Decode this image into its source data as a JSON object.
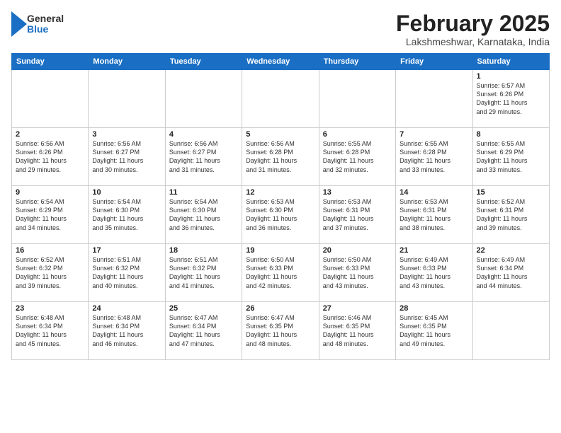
{
  "header": {
    "logo_general": "General",
    "logo_blue": "Blue",
    "month_title": "February 2025",
    "location": "Lakshmeshwar, Karnataka, India"
  },
  "days_of_week": [
    "Sunday",
    "Monday",
    "Tuesday",
    "Wednesday",
    "Thursday",
    "Friday",
    "Saturday"
  ],
  "weeks": [
    [
      {
        "day": "",
        "info": ""
      },
      {
        "day": "",
        "info": ""
      },
      {
        "day": "",
        "info": ""
      },
      {
        "day": "",
        "info": ""
      },
      {
        "day": "",
        "info": ""
      },
      {
        "day": "",
        "info": ""
      },
      {
        "day": "1",
        "info": "Sunrise: 6:57 AM\nSunset: 6:26 PM\nDaylight: 11 hours\nand 29 minutes."
      }
    ],
    [
      {
        "day": "2",
        "info": "Sunrise: 6:56 AM\nSunset: 6:26 PM\nDaylight: 11 hours\nand 29 minutes."
      },
      {
        "day": "3",
        "info": "Sunrise: 6:56 AM\nSunset: 6:27 PM\nDaylight: 11 hours\nand 30 minutes."
      },
      {
        "day": "4",
        "info": "Sunrise: 6:56 AM\nSunset: 6:27 PM\nDaylight: 11 hours\nand 31 minutes."
      },
      {
        "day": "5",
        "info": "Sunrise: 6:56 AM\nSunset: 6:28 PM\nDaylight: 11 hours\nand 31 minutes."
      },
      {
        "day": "6",
        "info": "Sunrise: 6:55 AM\nSunset: 6:28 PM\nDaylight: 11 hours\nand 32 minutes."
      },
      {
        "day": "7",
        "info": "Sunrise: 6:55 AM\nSunset: 6:28 PM\nDaylight: 11 hours\nand 33 minutes."
      },
      {
        "day": "8",
        "info": "Sunrise: 6:55 AM\nSunset: 6:29 PM\nDaylight: 11 hours\nand 33 minutes."
      }
    ],
    [
      {
        "day": "9",
        "info": "Sunrise: 6:54 AM\nSunset: 6:29 PM\nDaylight: 11 hours\nand 34 minutes."
      },
      {
        "day": "10",
        "info": "Sunrise: 6:54 AM\nSunset: 6:30 PM\nDaylight: 11 hours\nand 35 minutes."
      },
      {
        "day": "11",
        "info": "Sunrise: 6:54 AM\nSunset: 6:30 PM\nDaylight: 11 hours\nand 36 minutes."
      },
      {
        "day": "12",
        "info": "Sunrise: 6:53 AM\nSunset: 6:30 PM\nDaylight: 11 hours\nand 36 minutes."
      },
      {
        "day": "13",
        "info": "Sunrise: 6:53 AM\nSunset: 6:31 PM\nDaylight: 11 hours\nand 37 minutes."
      },
      {
        "day": "14",
        "info": "Sunrise: 6:53 AM\nSunset: 6:31 PM\nDaylight: 11 hours\nand 38 minutes."
      },
      {
        "day": "15",
        "info": "Sunrise: 6:52 AM\nSunset: 6:31 PM\nDaylight: 11 hours\nand 39 minutes."
      }
    ],
    [
      {
        "day": "16",
        "info": "Sunrise: 6:52 AM\nSunset: 6:32 PM\nDaylight: 11 hours\nand 39 minutes."
      },
      {
        "day": "17",
        "info": "Sunrise: 6:51 AM\nSunset: 6:32 PM\nDaylight: 11 hours\nand 40 minutes."
      },
      {
        "day": "18",
        "info": "Sunrise: 6:51 AM\nSunset: 6:32 PM\nDaylight: 11 hours\nand 41 minutes."
      },
      {
        "day": "19",
        "info": "Sunrise: 6:50 AM\nSunset: 6:33 PM\nDaylight: 11 hours\nand 42 minutes."
      },
      {
        "day": "20",
        "info": "Sunrise: 6:50 AM\nSunset: 6:33 PM\nDaylight: 11 hours\nand 43 minutes."
      },
      {
        "day": "21",
        "info": "Sunrise: 6:49 AM\nSunset: 6:33 PM\nDaylight: 11 hours\nand 43 minutes."
      },
      {
        "day": "22",
        "info": "Sunrise: 6:49 AM\nSunset: 6:34 PM\nDaylight: 11 hours\nand 44 minutes."
      }
    ],
    [
      {
        "day": "23",
        "info": "Sunrise: 6:48 AM\nSunset: 6:34 PM\nDaylight: 11 hours\nand 45 minutes."
      },
      {
        "day": "24",
        "info": "Sunrise: 6:48 AM\nSunset: 6:34 PM\nDaylight: 11 hours\nand 46 minutes."
      },
      {
        "day": "25",
        "info": "Sunrise: 6:47 AM\nSunset: 6:34 PM\nDaylight: 11 hours\nand 47 minutes."
      },
      {
        "day": "26",
        "info": "Sunrise: 6:47 AM\nSunset: 6:35 PM\nDaylight: 11 hours\nand 48 minutes."
      },
      {
        "day": "27",
        "info": "Sunrise: 6:46 AM\nSunset: 6:35 PM\nDaylight: 11 hours\nand 48 minutes."
      },
      {
        "day": "28",
        "info": "Sunrise: 6:45 AM\nSunset: 6:35 PM\nDaylight: 11 hours\nand 49 minutes."
      },
      {
        "day": "",
        "info": ""
      }
    ]
  ]
}
